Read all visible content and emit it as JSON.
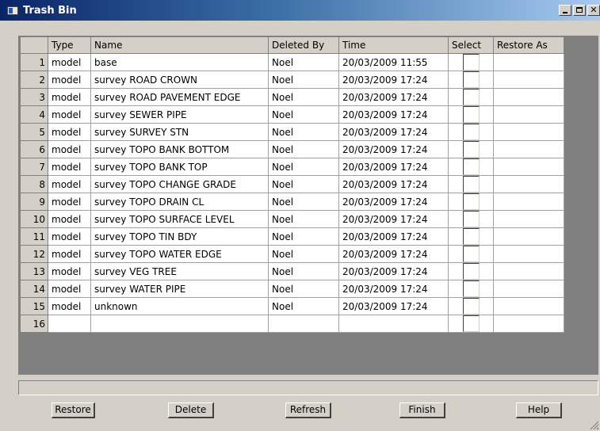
{
  "window": {
    "title": "Trash Bin",
    "icon": "app-window-icon",
    "controls": [
      "minimize-icon",
      "maximize-icon",
      "close-icon"
    ]
  },
  "table": {
    "headers": [
      "Type",
      "Name",
      "Deleted By",
      "Time",
      "Select",
      "Restore As"
    ],
    "rows": [
      {
        "num": "1",
        "type": "model",
        "name": "base",
        "deleted_by": "Noel",
        "time": "20/03/2009 11:55",
        "select": false,
        "restore_as": ""
      },
      {
        "num": "2",
        "type": "model",
        "name": "survey ROAD CROWN",
        "deleted_by": "Noel",
        "time": "20/03/2009 17:24",
        "select": false,
        "restore_as": ""
      },
      {
        "num": "3",
        "type": "model",
        "name": "survey ROAD PAVEMENT EDGE",
        "deleted_by": "Noel",
        "time": "20/03/2009 17:24",
        "select": false,
        "restore_as": ""
      },
      {
        "num": "4",
        "type": "model",
        "name": "survey SEWER PIPE",
        "deleted_by": "Noel",
        "time": "20/03/2009 17:24",
        "select": false,
        "restore_as": ""
      },
      {
        "num": "5",
        "type": "model",
        "name": "survey SURVEY STN",
        "deleted_by": "Noel",
        "time": "20/03/2009 17:24",
        "select": false,
        "restore_as": ""
      },
      {
        "num": "6",
        "type": "model",
        "name": "survey TOPO BANK BOTTOM",
        "deleted_by": "Noel",
        "time": "20/03/2009 17:24",
        "select": false,
        "restore_as": ""
      },
      {
        "num": "7",
        "type": "model",
        "name": "survey TOPO BANK TOP",
        "deleted_by": "Noel",
        "time": "20/03/2009 17:24",
        "select": false,
        "restore_as": ""
      },
      {
        "num": "8",
        "type": "model",
        "name": "survey TOPO CHANGE GRADE",
        "deleted_by": "Noel",
        "time": "20/03/2009 17:24",
        "select": false,
        "restore_as": ""
      },
      {
        "num": "9",
        "type": "model",
        "name": "survey TOPO DRAIN CL",
        "deleted_by": "Noel",
        "time": "20/03/2009 17:24",
        "select": false,
        "restore_as": ""
      },
      {
        "num": "10",
        "type": "model",
        "name": "survey TOPO SURFACE LEVEL",
        "deleted_by": "Noel",
        "time": "20/03/2009 17:24",
        "select": false,
        "restore_as": ""
      },
      {
        "num": "11",
        "type": "model",
        "name": "survey TOPO TIN BDY",
        "deleted_by": "Noel",
        "time": "20/03/2009 17:24",
        "select": false,
        "restore_as": ""
      },
      {
        "num": "12",
        "type": "model",
        "name": "survey TOPO WATER EDGE",
        "deleted_by": "Noel",
        "time": "20/03/2009 17:24",
        "select": false,
        "restore_as": ""
      },
      {
        "num": "13",
        "type": "model",
        "name": "survey VEG TREE",
        "deleted_by": "Noel",
        "time": "20/03/2009 17:24",
        "select": false,
        "restore_as": ""
      },
      {
        "num": "14",
        "type": "model",
        "name": "survey WATER PIPE",
        "deleted_by": "Noel",
        "time": "20/03/2009 17:24",
        "select": false,
        "restore_as": ""
      },
      {
        "num": "15",
        "type": "model",
        "name": "unknown",
        "deleted_by": "Noel",
        "time": "20/03/2009 17:24",
        "select": false,
        "restore_as": ""
      },
      {
        "num": "16",
        "type": "",
        "name": "",
        "deleted_by": "",
        "time": "",
        "select": false,
        "restore_as": ""
      }
    ]
  },
  "status": {
    "text": ""
  },
  "buttons": {
    "restore": "Restore",
    "delete": "Delete",
    "refresh": "Refresh",
    "finish": "Finish",
    "help": "Help"
  },
  "colors": {
    "titlebar_start": "#0a246a",
    "titlebar_end": "#a6caf0",
    "face": "#d4d0c8",
    "grid_background": "#808080"
  }
}
